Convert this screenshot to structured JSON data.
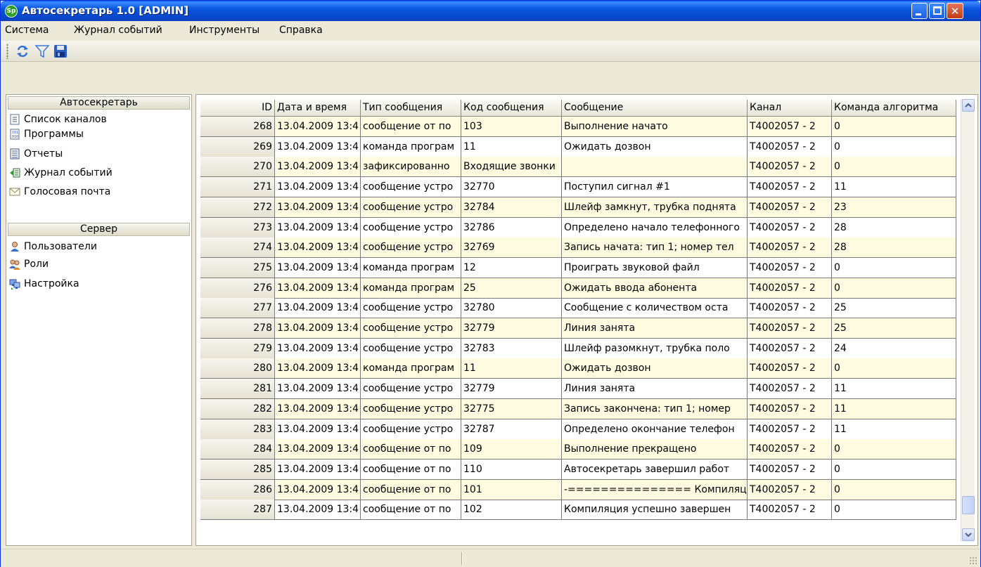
{
  "window": {
    "logo_text": "Sp",
    "title": "Автосекретарь 1.0 [ADMIN]"
  },
  "menu": [
    {
      "label": "Система"
    },
    {
      "label": "Журнал событий"
    },
    {
      "label": "Инструменты"
    },
    {
      "label": "Справка"
    }
  ],
  "toolbar": {
    "icons": [
      "refresh-icon",
      "filter-icon",
      "save-icon"
    ]
  },
  "sidebar": {
    "group1": {
      "title": "Автосекретарь",
      "items": [
        {
          "label": "Список каналов",
          "icon": "channel-list-icon"
        },
        {
          "label": "Программы",
          "icon": "programs-icon"
        },
        {
          "label": "Отчеты",
          "icon": "reports-icon"
        },
        {
          "label": "Журнал событий",
          "icon": "event-log-icon"
        },
        {
          "label": "Голосовая почта",
          "icon": "voicemail-envelope-icon"
        }
      ]
    },
    "group2": {
      "title": "Сервер",
      "items": [
        {
          "label": "Пользователи",
          "icon": "user-icon"
        },
        {
          "label": "Роли",
          "icon": "roles-icon"
        },
        {
          "label": "Настройка",
          "icon": "settings-icon"
        }
      ]
    }
  },
  "grid": {
    "columns": [
      "ID",
      "Дата и время",
      "Тип сообщения",
      "Код сообщения",
      "Сообщение",
      "Канал",
      "Команда алгоритма"
    ],
    "rows": [
      [
        "268",
        "13.04.2009 13:4",
        "сообщение от по",
        "103",
        "Выполнение начато",
        "T4002057 - 2",
        "0"
      ],
      [
        "269",
        "13.04.2009 13:4",
        "команда програм",
        "11",
        "Ожидать дозвон",
        "T4002057 - 2",
        "0"
      ],
      [
        "270",
        "13.04.2009 13:4",
        "зафиксированно",
        "Входящие звонки",
        "",
        "T4002057 - 2",
        "0"
      ],
      [
        "271",
        "13.04.2009 13:4",
        "сообщение устро",
        "32770",
        "Поступил сигнал #1",
        "T4002057 - 2",
        "11"
      ],
      [
        "272",
        "13.04.2009 13:4",
        "сообщение устро",
        "32784",
        "Шлейф замкнут, трубка поднята",
        "T4002057 - 2",
        "23"
      ],
      [
        "273",
        "13.04.2009 13:4",
        "сообщение устро",
        "32786",
        "Определено начало телефонного",
        "T4002057 - 2",
        "28"
      ],
      [
        "274",
        "13.04.2009 13:4",
        "сообщение устро",
        "32769",
        "Запись начата: тип 1; номер тел",
        "T4002057 - 2",
        "28"
      ],
      [
        "275",
        "13.04.2009 13:4",
        "команда програм",
        "12",
        "Проиграть звуковой файл",
        "T4002057 - 2",
        "0"
      ],
      [
        "276",
        "13.04.2009 13:4",
        "команда програм",
        "25",
        "Ожидать ввода абонента",
        "T4002057 - 2",
        "0"
      ],
      [
        "277",
        "13.04.2009 13:4",
        "сообщение устро",
        "32780",
        "Сообщение с количеством оста",
        "T4002057 - 2",
        "25"
      ],
      [
        "278",
        "13.04.2009 13:4",
        "сообщение устро",
        "32779",
        "Линия занята",
        "T4002057 - 2",
        "25"
      ],
      [
        "279",
        "13.04.2009 13:4",
        "сообщение устро",
        "32783",
        "Шлейф разомкнут, трубка поло",
        "T4002057 - 2",
        "24"
      ],
      [
        "280",
        "13.04.2009 13:4",
        "команда програм",
        "11",
        "Ожидать дозвон",
        "T4002057 - 2",
        "0"
      ],
      [
        "281",
        "13.04.2009 13:4",
        "сообщение устро",
        "32779",
        "Линия занята",
        "T4002057 - 2",
        "11"
      ],
      [
        "282",
        "13.04.2009 13:4",
        "сообщение устро",
        "32775",
        "Запись закончена: тип 1; номер",
        "T4002057 - 2",
        "11"
      ],
      [
        "283",
        "13.04.2009 13:4",
        "сообщение устро",
        "32787",
        "Определено окончание телефон",
        "T4002057 - 2",
        "11"
      ],
      [
        "284",
        "13.04.2009 13:4",
        "сообщение от по",
        "109",
        "Выполнение прекращено",
        "T4002057 - 2",
        "0"
      ],
      [
        "285",
        "13.04.2009 13:4",
        "сообщение от по",
        "110",
        "Автосекретарь завершил работ",
        "T4002057 - 2",
        "0"
      ],
      [
        "286",
        "13.04.2009 13:4",
        "сообщение от по",
        "101",
        "-=============== Компиляция",
        "T4002057 - 2",
        "0"
      ],
      [
        "287",
        "13.04.2009 13:4",
        "сообщение от по",
        "102",
        "Компиляция успешно завершен",
        "T4002057 - 2",
        "0"
      ]
    ]
  },
  "colors": {
    "title_bar": "#0855dd",
    "alt_row": "#fefbe0",
    "window_bg": "#ece9d8"
  }
}
